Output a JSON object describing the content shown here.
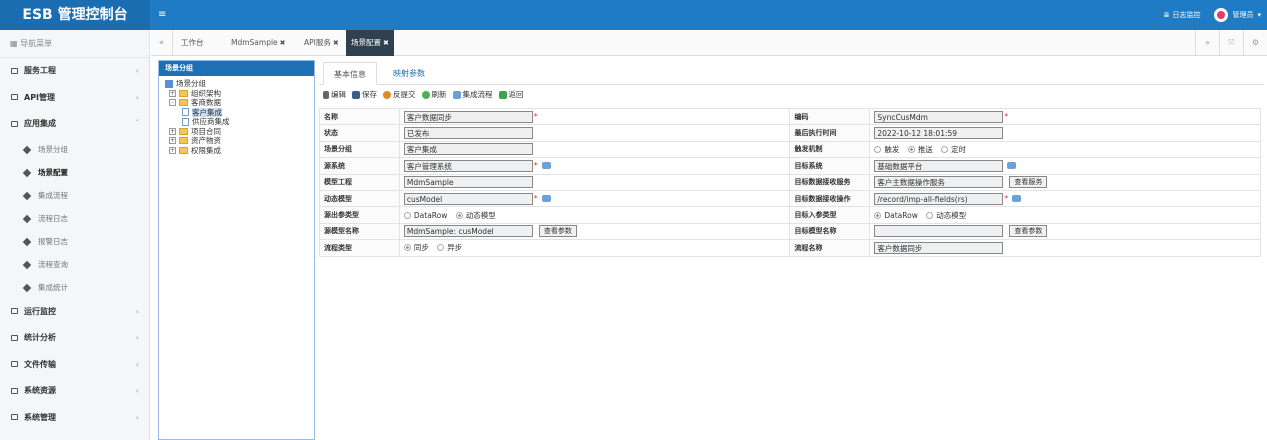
{
  "header": {
    "brand": "ESB 管理控制台",
    "menu_glyph": "≡",
    "log_monitor": "日志监控",
    "user": "管理员"
  },
  "sidebar": {
    "title": "导航菜单",
    "items": [
      {
        "label": "服务工程",
        "chev": "‹"
      },
      {
        "label": "API管理",
        "chev": "‹"
      },
      {
        "label": "应用集成",
        "chev": "ˇ"
      },
      {
        "label": "运行监控",
        "chev": "‹"
      },
      {
        "label": "统计分析",
        "chev": "‹"
      },
      {
        "label": "文件传输",
        "chev": "‹"
      },
      {
        "label": "系统资源",
        "chev": "‹"
      },
      {
        "label": "系统管理",
        "chev": "‹"
      }
    ],
    "sub_items": [
      "场景分组",
      "场景配置",
      "集成流程",
      "流程日志",
      "报警日志",
      "流程查询",
      "集成统计"
    ]
  },
  "tabs": {
    "items": [
      {
        "label": "工作台",
        "closable": false
      },
      {
        "label": "MdmSample",
        "closable": true
      },
      {
        "label": "API服务",
        "closable": true
      },
      {
        "label": "场景配置",
        "closable": true,
        "active": true
      }
    ],
    "close_glyph": "✖"
  },
  "tree": {
    "title": "场景分组",
    "root": "场景分组",
    "nodes": [
      {
        "label": "组织架构",
        "toggle": "+",
        "level": 1
      },
      {
        "label": "客商数据",
        "toggle": "-",
        "level": 1
      },
      {
        "label": "客户集成",
        "level": 2,
        "selected": true
      },
      {
        "label": "供应商集成",
        "level": 2
      },
      {
        "label": "项目合同",
        "toggle": "+",
        "level": 1
      },
      {
        "label": "资产物资",
        "toggle": "+",
        "level": 1
      },
      {
        "label": "权限集成",
        "toggle": "+",
        "level": 1
      }
    ]
  },
  "content_tabs": [
    "基本信息",
    "映射参数"
  ],
  "toolbar": [
    "编辑",
    "保存",
    "反提交",
    "刷新",
    "集成流程",
    "返回"
  ],
  "form": {
    "name_label": "名称",
    "name_value": "客户数据同步",
    "code_label": "编码",
    "code_value": "SyncCusMdm",
    "status_label": "状态",
    "status_value": "已发布",
    "last_exec_label": "最后执行时间",
    "last_exec_value": "2022-10-12 18:01:59",
    "group_label": "场景分组",
    "group_value": "客户集成",
    "trigger_label": "触发机制",
    "trigger_options": [
      "触发",
      "推送",
      "定时"
    ],
    "source_sys_label": "源系统",
    "source_sys_value": "客户管理系统",
    "target_sys_label": "目标系统",
    "target_sys_value": "基础数据平台",
    "model_project_label": "模型工程",
    "model_project_value": "MdmSample",
    "target_service_label": "目标数据接收服务",
    "target_service_value": "客户主数据操作服务",
    "view_service_btn": "查看服务",
    "dynamic_model_label": "动态模型",
    "dynamic_model_value": "cusModel",
    "target_op_label": "目标数据接收操作",
    "target_op_value": "/record/imp-all-fields(rs)",
    "out_param_label": "源出参类型",
    "out_param_options": [
      "DataRow",
      "动态模型"
    ],
    "in_param_label": "目标入参类型",
    "in_param_options": [
      "DataRow",
      "动态模型"
    ],
    "src_model_label": "源模型名称",
    "src_model_value": "MdmSample: cusModel",
    "view_params_btn": "查看参数",
    "tgt_model_label": "目标模型名称",
    "tgt_model_value": "",
    "view_params_btn2": "查看参数",
    "flow_type_label": "流程类型",
    "flow_type_options": [
      "同步",
      "异步"
    ],
    "flow_name_label": "流程名称",
    "flow_name_value": "客户数据同步",
    "required_mark": "*"
  },
  "colors": {
    "header": "#1f7bc4",
    "brand_bg": "#1a6db0",
    "tab_active": "#2f4050",
    "tree_head": "#1f6fb5"
  }
}
